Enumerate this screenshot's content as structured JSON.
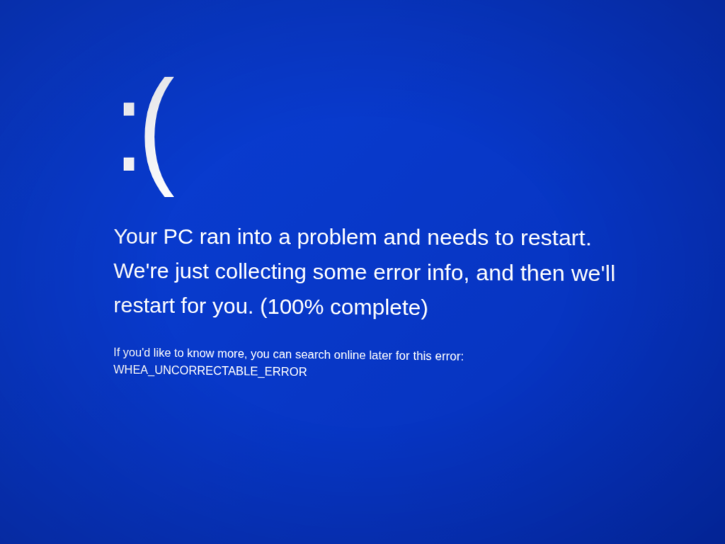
{
  "bsod": {
    "emoticon": ":(",
    "message": "Your PC ran into a problem and needs to restart. We're just collecting some error info, and then we'll restart for you. (100% complete)",
    "hint": "If you'd like to know more, you can search online later for this error: WHEA_UNCORRECTABLE_ERROR"
  }
}
